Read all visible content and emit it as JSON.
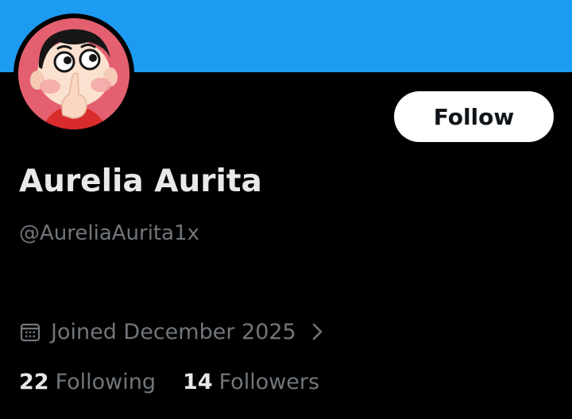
{
  "profile": {
    "banner_color": "#1d9bf0",
    "avatar_icon": "cartoon-boy-avatar",
    "name": "Aurelia Aurita",
    "handle": "@AureliaAurita1x",
    "joined": "Joined December 2025",
    "joined_icon": "calendar-icon",
    "joined_chevron_icon": "chevron-right-icon",
    "follow_button_label": "Follow",
    "stats": {
      "following_count": "22",
      "following_label": "Following",
      "followers_count": "14",
      "followers_label": "Followers"
    }
  },
  "colors": {
    "background": "#000000",
    "primary_text": "#e7e9ea",
    "secondary_text": "#71767b",
    "button_background": "#ffffff",
    "button_text": "#0f1419"
  }
}
